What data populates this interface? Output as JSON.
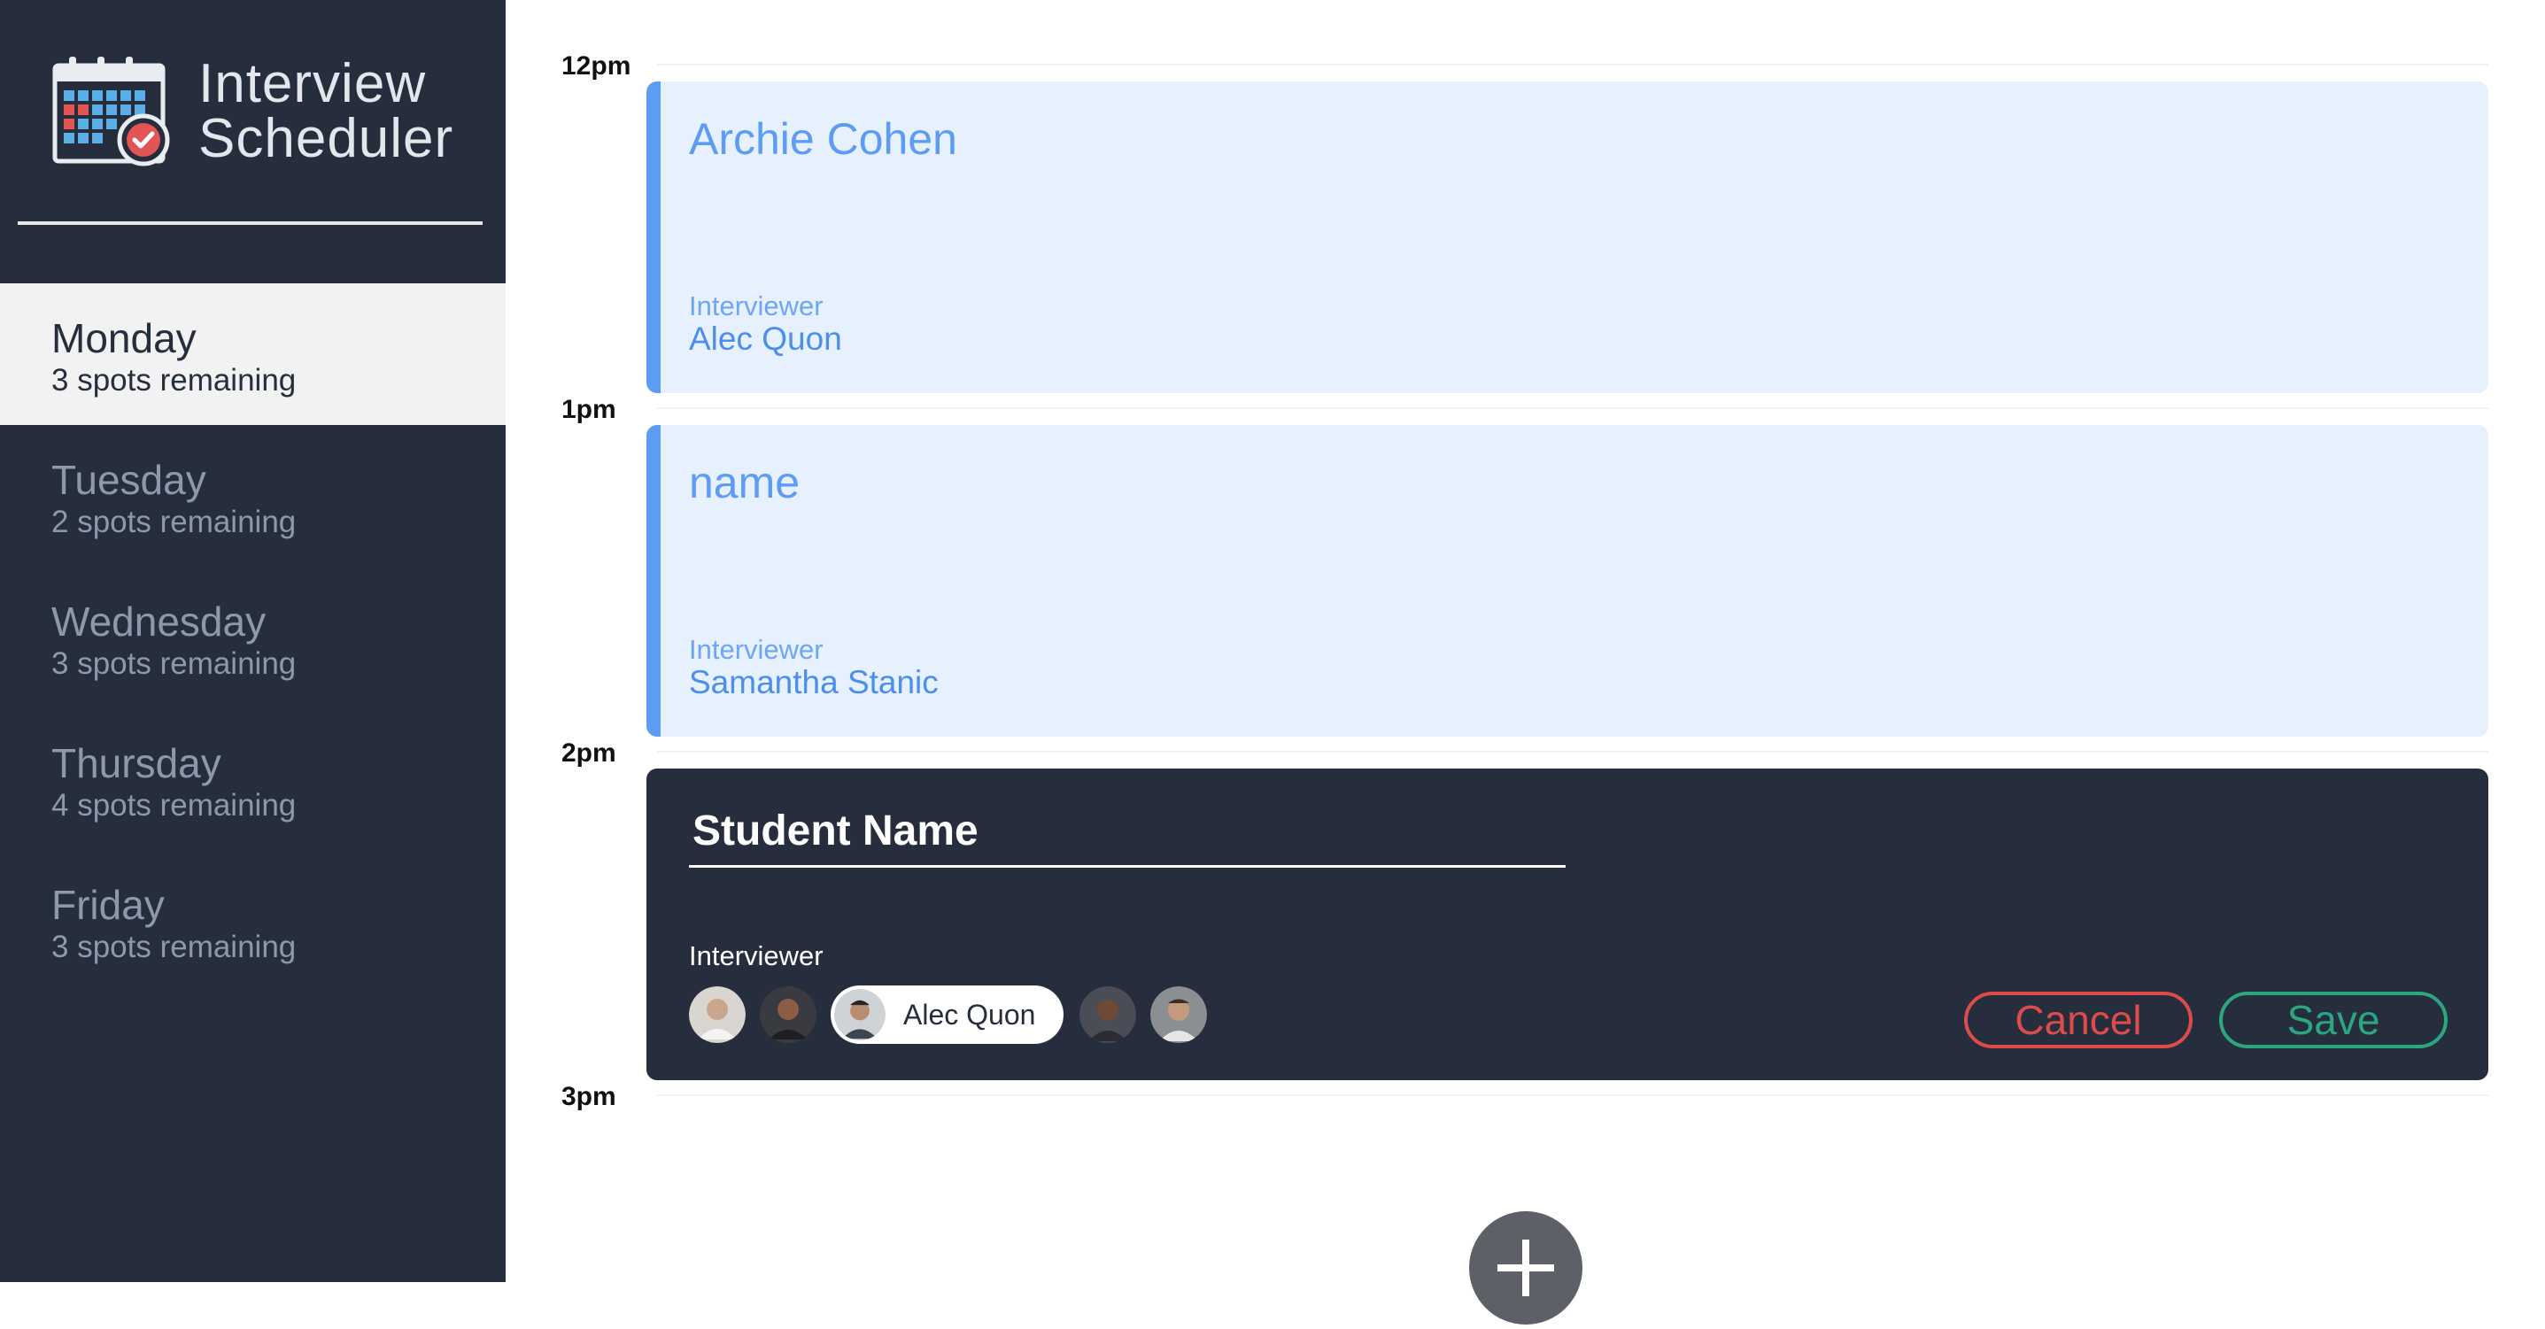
{
  "app": {
    "title_line1": "Interview",
    "title_line2": "Scheduler"
  },
  "sidebar": {
    "days": [
      {
        "name": "Monday",
        "spots": "3 spots remaining",
        "selected": true
      },
      {
        "name": "Tuesday",
        "spots": "2 spots remaining",
        "selected": false
      },
      {
        "name": "Wednesday",
        "spots": "3 spots remaining",
        "selected": false
      },
      {
        "name": "Thursday",
        "spots": "4 spots remaining",
        "selected": false
      },
      {
        "name": "Friday",
        "spots": "3 spots remaining",
        "selected": false
      }
    ]
  },
  "schedule": {
    "hours": [
      "12pm",
      "1pm",
      "2pm",
      "3pm"
    ],
    "appointments": [
      {
        "student": "Archie Cohen",
        "interviewer_label": "Interviewer",
        "interviewer": "Alec Quon"
      },
      {
        "student": "name",
        "interviewer_label": "Interviewer",
        "interviewer": "Samantha Stanic"
      }
    ],
    "form": {
      "student_placeholder": "Student Name",
      "interviewer_label": "Interviewer",
      "selected_interviewer": "Alec Quon",
      "cancel_label": "Cancel",
      "save_label": "Save"
    }
  },
  "icons": {
    "logo": "calendar-check-icon",
    "add": "plus-icon"
  },
  "colors": {
    "sidebar_bg": "#262e3e",
    "appointment_bg": "#e7f0fd",
    "appointment_accent": "#5c9cf2",
    "cancel": "#dd4b4b",
    "save": "#2aa781"
  }
}
